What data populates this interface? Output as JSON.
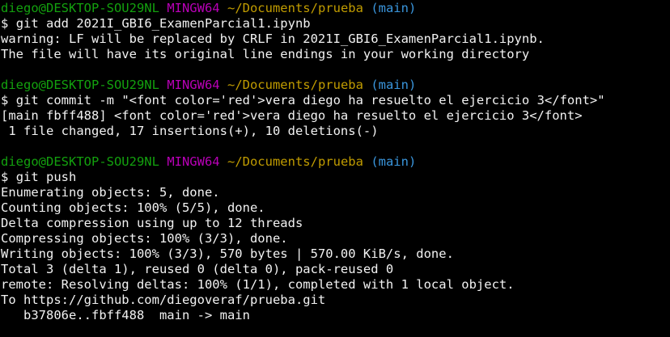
{
  "prompt": {
    "user_host": "diego@DESKTOP-SOU29NL",
    "system": "MINGW64",
    "path": "~/Documents/prueba",
    "branch": "(main)",
    "symbol": "$"
  },
  "colors": {
    "background": "#000000",
    "text": "#f2f2f2",
    "user_host": "#13a10e",
    "system": "#b900b7",
    "path": "#c19c00",
    "branch": "#3a96dd"
  },
  "blocks": [
    {
      "command": "git add 2021I_GBI6_ExamenParcial1.ipynb",
      "output": [
        "warning: LF will be replaced by CRLF in 2021I_GBI6_ExamenParcial1.ipynb.",
        "The file will have its original line endings in your working directory"
      ]
    },
    {
      "command": "git commit -m \"<font color='red'>vera diego ha resuelto el ejercicio 3</font>\"",
      "output": [
        "[main fbff488] <font color='red'>vera diego ha resuelto el ejercicio 3</font>",
        " 1 file changed, 17 insertions(+), 10 deletions(-)"
      ]
    },
    {
      "command": "git push",
      "output": [
        "Enumerating objects: 5, done.",
        "Counting objects: 100% (5/5), done.",
        "Delta compression using up to 12 threads",
        "Compressing objects: 100% (3/3), done.",
        "Writing objects: 100% (3/3), 570 bytes | 570.00 KiB/s, done.",
        "Total 3 (delta 1), reused 0 (delta 0), pack-reused 0",
        "remote: Resolving deltas: 100% (1/1), completed with 1 local object.",
        "To https://github.com/diegoveraf/prueba.git",
        "   b37806e..fbff488  main -> main"
      ]
    }
  ]
}
